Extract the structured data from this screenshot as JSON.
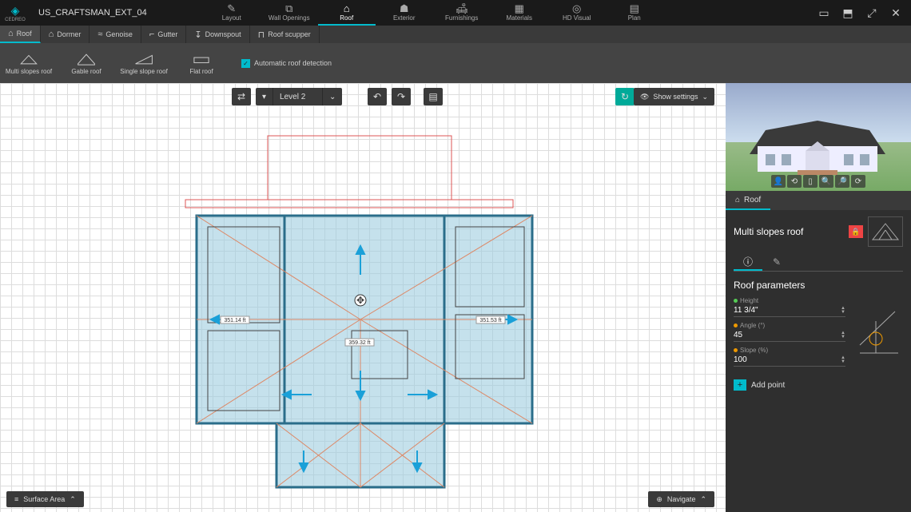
{
  "app_brand": "CEDREO",
  "project_name": "US_CRAFTSMAN_EXT_04",
  "nav_tabs": [
    {
      "label": "Layout",
      "icon": "✎"
    },
    {
      "label": "Wall Openings",
      "icon": "⧉"
    },
    {
      "label": "Roof",
      "icon": "⌂",
      "active": true
    },
    {
      "label": "Exterior",
      "icon": "☗"
    },
    {
      "label": "Furnishings",
      "icon": "🛋"
    },
    {
      "label": "Materials",
      "icon": "▦"
    },
    {
      "label": "HD Visual",
      "icon": "◎"
    },
    {
      "label": "Plan",
      "icon": "▤"
    }
  ],
  "sub_tabs": [
    {
      "label": "Roof",
      "icon": "⌂",
      "active": true
    },
    {
      "label": "Dormer",
      "icon": "⌂"
    },
    {
      "label": "Genoise",
      "icon": "~~~"
    },
    {
      "label": "Gutter",
      "icon": "⌐"
    },
    {
      "label": "Downspout",
      "icon": "↓"
    },
    {
      "label": "Roof scupper",
      "icon": "⊓"
    }
  ],
  "roof_tools": [
    {
      "label": "Multi slopes roof"
    },
    {
      "label": "Gable roof"
    },
    {
      "label": "Single slope roof"
    },
    {
      "label": "Flat roof"
    }
  ],
  "auto_detection_label": "Automatic roof detection",
  "level_selector": "Level 2",
  "show_settings_label": "Show settings",
  "surface_area_label": "Surface Area",
  "navigate_label": "Navigate",
  "right_panel": {
    "section_label": "Roof",
    "selected_type": "Multi slopes roof",
    "params_title": "Roof parameters",
    "params": {
      "height": {
        "label": "Height",
        "value": "11 3/4\""
      },
      "angle": {
        "label": "Angle (°)",
        "value": "45"
      },
      "slope": {
        "label": "Slope (%)",
        "value": "100"
      }
    },
    "add_point_label": "Add point"
  },
  "dims": {
    "a": "351.14 ft",
    "b": "359.32 ft",
    "c": "351.53 ft"
  }
}
